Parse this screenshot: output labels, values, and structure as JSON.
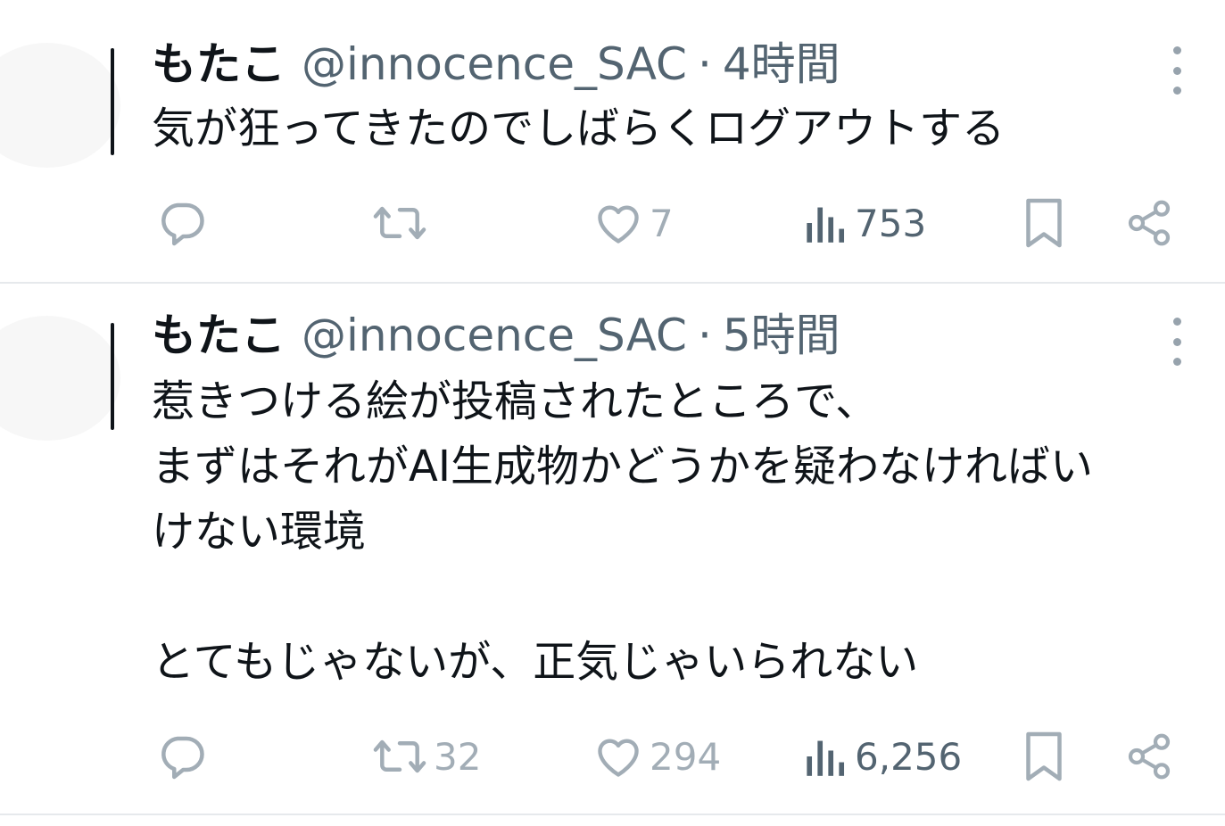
{
  "tweets": [
    {
      "name": "もたこ",
      "handle": "@innocence_SAC",
      "separator": "·",
      "time": "4時間",
      "text": "気が狂ってきたのでしばらくログアウトする",
      "reply_count": "",
      "retweet_count": "",
      "like_count": "7",
      "view_count": "753"
    },
    {
      "name": "もたこ",
      "handle": "@innocence_SAC",
      "separator": "·",
      "time": "5時間",
      "text": "惹きつける絵が投稿されたところで、\nまずはそれがAI生成物かどうかを疑わなければい\nけない環境\n\nとてもじゃないが、正気じゃいられない",
      "reply_count": "",
      "retweet_count": "32",
      "like_count": "294",
      "view_count": "6,256"
    }
  ],
  "colors": {
    "text": "#0f1419",
    "secondary": "#536471",
    "icon": "#a2adb6",
    "divider": "#e6e9ec"
  },
  "icons": [
    "reply-icon",
    "retweet-icon",
    "like-icon",
    "views-icon",
    "bookmark-icon",
    "share-icon",
    "more-icon"
  ]
}
